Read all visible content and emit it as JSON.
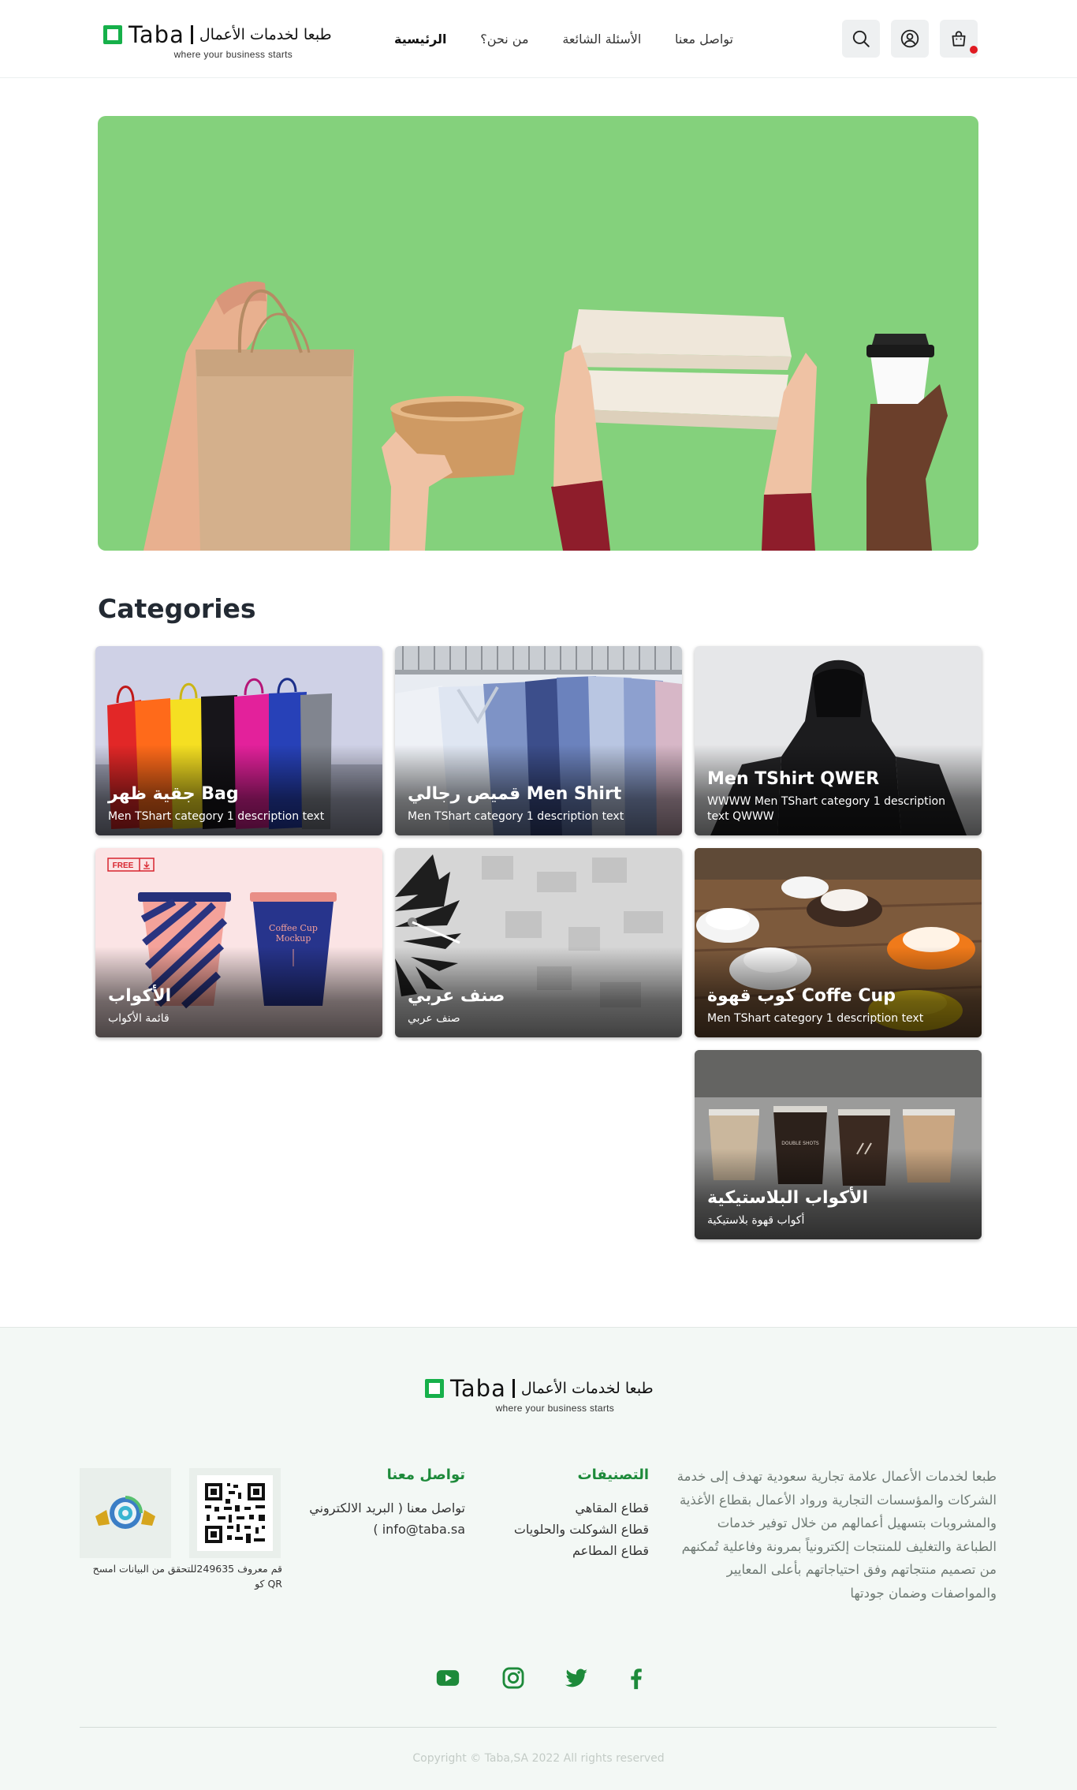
{
  "brand": {
    "name_latin": "Taba",
    "name_arabic": "طبعا لخدمات الأعمال",
    "tagline": "where your business starts",
    "accent": "#16b04a",
    "footer_accent": "#1d8a3a"
  },
  "nav": {
    "items": [
      {
        "label": "الرئيسية",
        "active": true
      },
      {
        "label": "من نحن؟",
        "active": false
      },
      {
        "label": "الأسئلة الشائعة",
        "active": false
      },
      {
        "label": "تواصل معنا",
        "active": false
      }
    ]
  },
  "header_actions": {
    "search_icon": "search-icon",
    "account_icon": "user-circle-icon",
    "cart_icon": "shopping-bag-icon",
    "cart_badge_color": "#e01b22"
  },
  "hero": {
    "background": "#84d17c",
    "illustration": "hands holding paper bag, kraft bowl, food boxes and coffee cup"
  },
  "categories": {
    "title": "Categories",
    "items": [
      {
        "name": "جقية ظهر Bag",
        "desc": "Men TShart category 1 description text",
        "art": "bags"
      },
      {
        "name": "قميص رجالي Men Shirt",
        "desc": "Men TShart category 1 description text",
        "art": "shirts"
      },
      {
        "name": "Men TShirt QWER",
        "desc": "WWWW Men TShart category 1 description text QWWW",
        "art": "hoodie"
      },
      {
        "name": "الأكواب",
        "desc": "قائمة الأكواب",
        "art": "cups",
        "badge": "FREE"
      },
      {
        "name": "صنف عربي",
        "desc": "صنف عربي",
        "art": "clock"
      },
      {
        "name": "كوب قهوة Coffe Cup",
        "desc": "Men TShart category 1 description text",
        "art": "coffee"
      },
      {
        "name": "الأكواب البلاستيكية",
        "desc": "أكواب قهوة بلاستيكية",
        "art": "plastic",
        "cup_label": "DOUBLE SHOTS"
      }
    ]
  },
  "footer": {
    "about": "طبعا لخدمات الأعمال علامة تجارية سعودية تهدف إلى خدمة الشركات والمؤسسات التجارية ورواد الأعمال بقطاع الأغذية والمشروبات بتسهيل أعمالهم من خلال توفير خدمات الطباعة والتغليف للمنتجات إلكترونياً بمرونة وفاعلية تُمكنهم من تصميم منتجاتهم وفق احتياجاتهم بأعلى المعايير والمواصفات وضمان جودتها",
    "categories_title": "التصنيفات",
    "categories": [
      "قطاع المقاهي",
      "قطاع الشوكلت والحلويات",
      "قطاع المطاعم"
    ],
    "contact_title": "تواصل معنا",
    "contact_line_1": "تواصل معنا ( البريد الالكتروني",
    "contact_line_2": "info@taba.sa )",
    "verify_text": "قم معروف 249635للتحقق من البيانات امسح QR كو",
    "social": [
      "youtube-icon",
      "instagram-icon",
      "twitter-icon",
      "facebook-icon"
    ],
    "copyright": "Copyright © Taba,SA 2022 All rights reserved"
  }
}
